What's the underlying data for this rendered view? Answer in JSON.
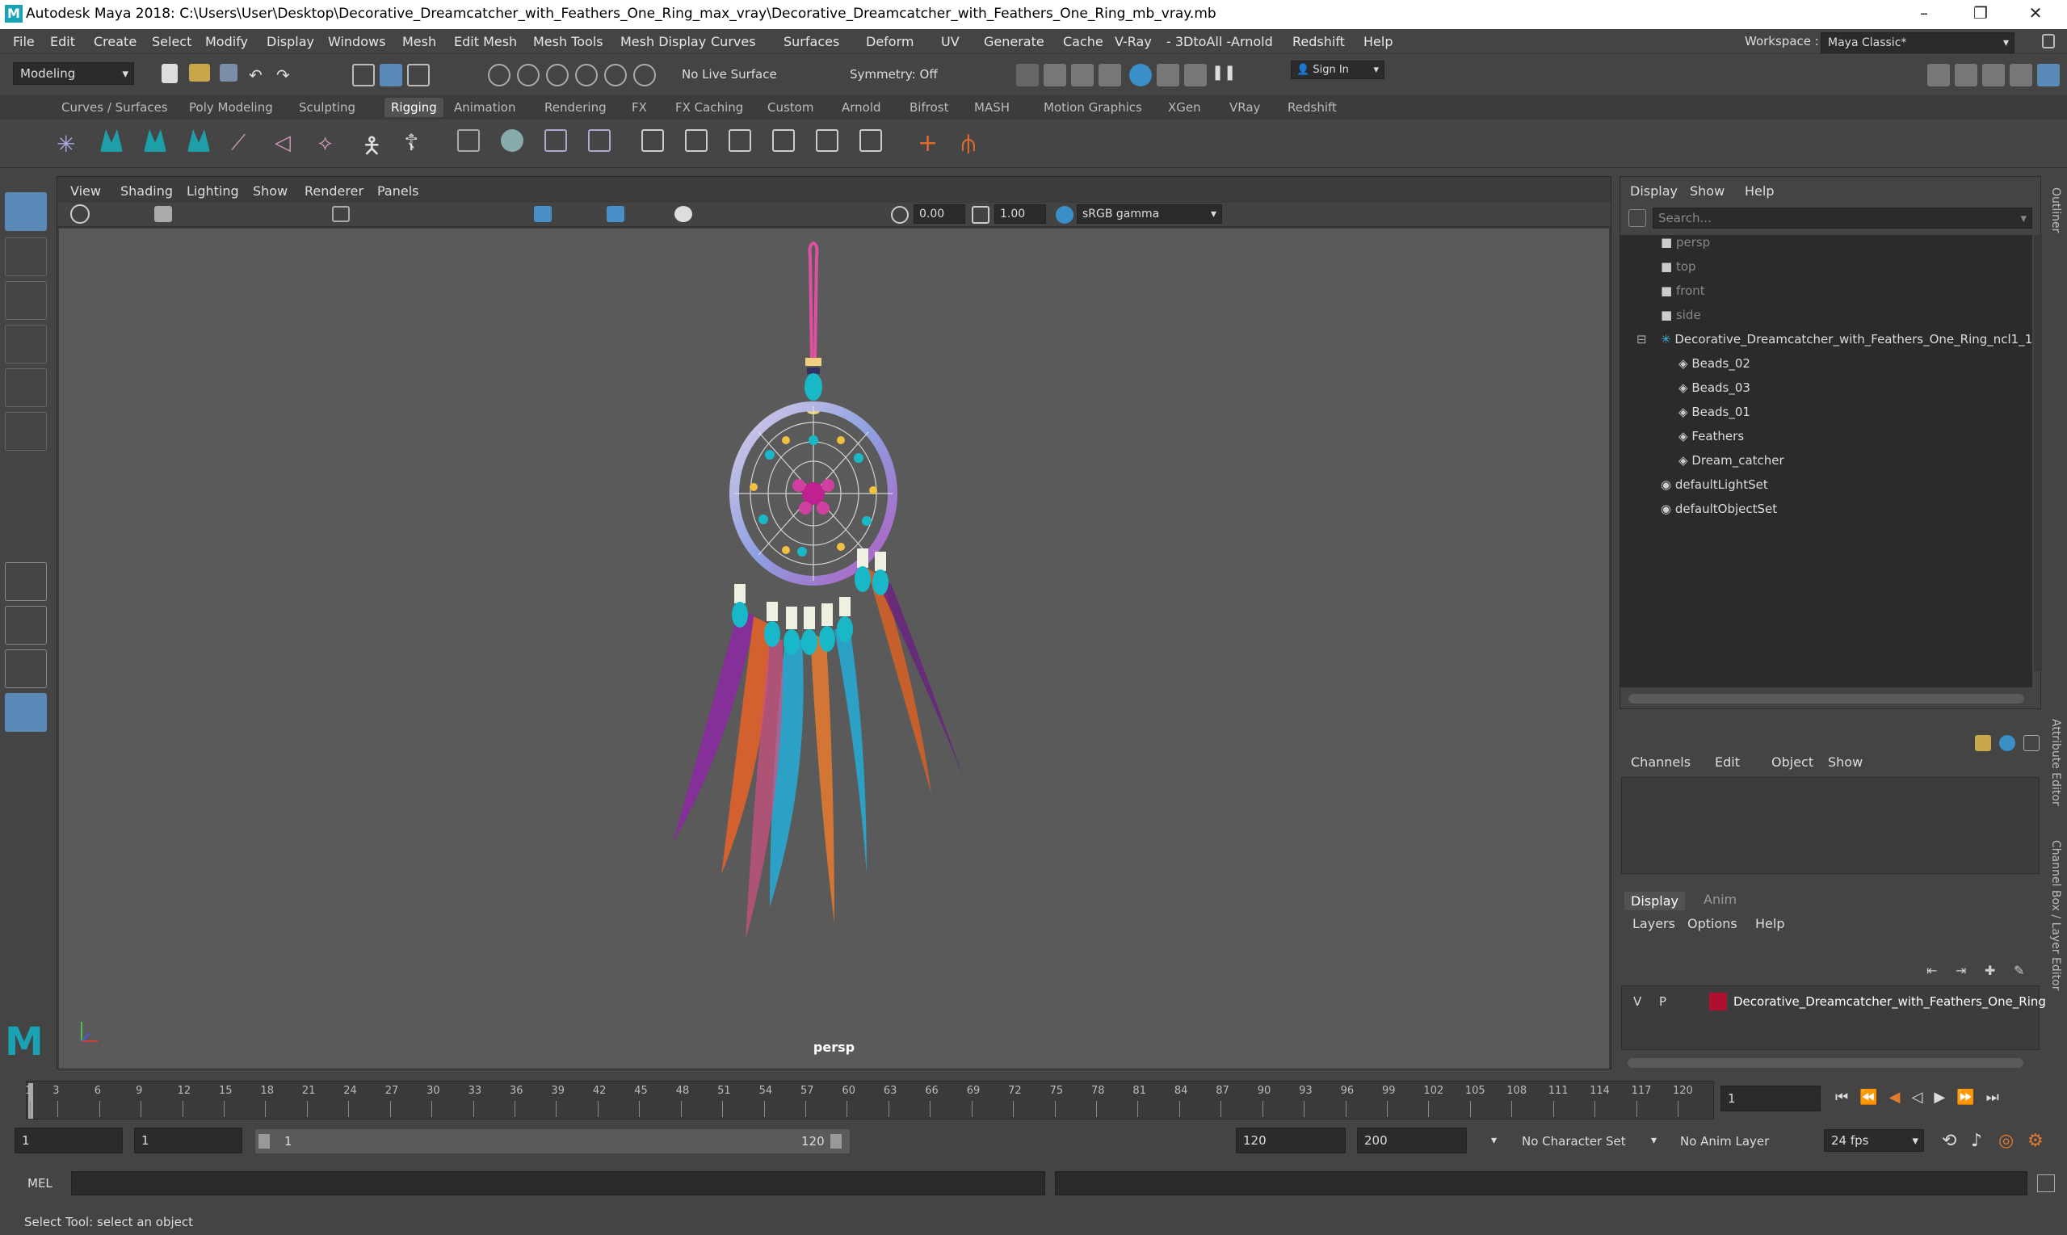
{
  "window": {
    "title": "Autodesk Maya 2018: C:\\Users\\User\\Desktop\\Decorative_Dreamcatcher_with_Feathers_One_Ring_max_vray\\Decorative_Dreamcatcher_with_Feathers_One_Ring_mb_vray.mb",
    "minimize": "–",
    "maximize": "❐",
    "close": "✕"
  },
  "menubar": [
    "File",
    "Edit",
    "Create",
    "Select",
    "Modify",
    "Display",
    "Windows",
    "Mesh",
    "Edit Mesh",
    "Mesh Tools",
    "Mesh Display",
    "Curves",
    "Surfaces",
    "Deform",
    "UV",
    "Generate",
    "Cache",
    "V-Ray",
    "- 3DtoAll -",
    "Arnold",
    "Redshift",
    "Help"
  ],
  "workspace": {
    "label": "Workspace :",
    "value": "Maya Classic*"
  },
  "statusline": {
    "mode": "Modeling",
    "live_surface": "No Live Surface",
    "symmetry": "Symmetry: Off",
    "sign_in": "Sign In"
  },
  "shelf_tabs": [
    "Curves / Surfaces",
    "Poly Modeling",
    "Sculpting",
    "Rigging",
    "Animation",
    "Rendering",
    "FX",
    "FX Caching",
    "Custom",
    "Arnold",
    "Bifrost",
    "MASH",
    "Motion Graphics",
    "XGen",
    "VRay",
    "Redshift"
  ],
  "active_shelf": "Rigging",
  "viewport": {
    "menu": [
      "View",
      "Shading",
      "Lighting",
      "Show",
      "Renderer",
      "Panels"
    ],
    "exposure": "0.00",
    "gamma": "1.00",
    "color_space": "sRGB gamma",
    "camera_label": "persp"
  },
  "outliner": {
    "menu": [
      "Display",
      "Show",
      "Help"
    ],
    "search_placeholder": "Search...",
    "items": [
      {
        "label": "persp",
        "dim": true,
        "indent": 1,
        "icon": "camera-icon"
      },
      {
        "label": "top",
        "dim": true,
        "indent": 1,
        "icon": "camera-icon"
      },
      {
        "label": "front",
        "dim": true,
        "indent": 1,
        "icon": "camera-icon"
      },
      {
        "label": "side",
        "dim": true,
        "indent": 1,
        "icon": "camera-icon"
      },
      {
        "label": "Decorative_Dreamcatcher_with_Feathers_One_Ring_ncl1_1",
        "dim": false,
        "indent": 1,
        "icon": "group-icon"
      },
      {
        "label": "Beads_02",
        "dim": false,
        "indent": 2,
        "icon": "mesh-icon"
      },
      {
        "label": "Beads_03",
        "dim": false,
        "indent": 2,
        "icon": "mesh-icon"
      },
      {
        "label": "Beads_01",
        "dim": false,
        "indent": 2,
        "icon": "mesh-icon"
      },
      {
        "label": "Feathers",
        "dim": false,
        "indent": 2,
        "icon": "mesh-icon"
      },
      {
        "label": "Dream_catcher",
        "dim": false,
        "indent": 2,
        "icon": "mesh-icon"
      },
      {
        "label": "defaultLightSet",
        "dim": false,
        "indent": 1,
        "icon": "set-icon"
      },
      {
        "label": "defaultObjectSet",
        "dim": false,
        "indent": 1,
        "icon": "set-icon"
      }
    ]
  },
  "channel_box": {
    "menu": [
      "Channels",
      "Edit",
      "Object",
      "Show"
    ]
  },
  "layer_editor": {
    "tabs": [
      "Display",
      "Anim"
    ],
    "menu": [
      "Layers",
      "Options",
      "Help"
    ],
    "layer": {
      "visible": "V",
      "playback": "P",
      "name": "Decorative_Dreamcatcher_with_Feathers_One_Ring",
      "color": "#b01030"
    }
  },
  "side_tabs": [
    "Outliner",
    "Attribute Editor",
    "Channel Box / Layer Editor"
  ],
  "timeline": {
    "ticks": [
      "1",
      "3",
      "6",
      "9",
      "12",
      "15",
      "18",
      "21",
      "24",
      "27",
      "30",
      "33",
      "36",
      "39",
      "42",
      "45",
      "48",
      "51",
      "54",
      "57",
      "60",
      "63",
      "66",
      "69",
      "72",
      "75",
      "78",
      "81",
      "84",
      "87",
      "90",
      "93",
      "96",
      "99",
      "102",
      "105",
      "108",
      "111",
      "114",
      "117",
      "120"
    ],
    "current_frame": "1"
  },
  "range": {
    "start": "1",
    "anim_start": "1",
    "slider_start": "1",
    "slider_end": "120",
    "anim_end": "120",
    "end": "200",
    "character_set": "No Character Set",
    "anim_layer": "No Anim Layer",
    "fps": "24 fps"
  },
  "command": {
    "language": "MEL"
  },
  "help_line": "Select Tool: select an object"
}
